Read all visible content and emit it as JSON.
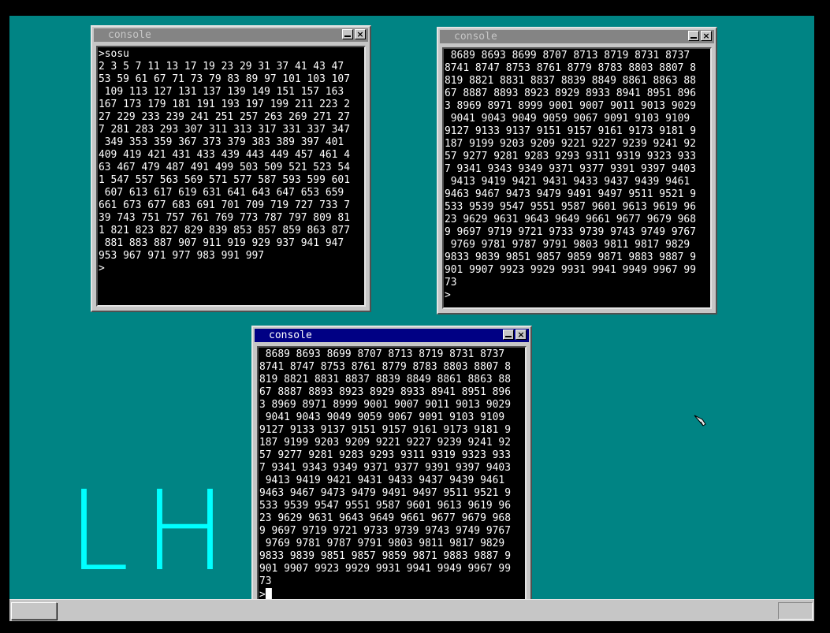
{
  "desktop": {
    "background": "#008484",
    "logo": {
      "letter_l": "L",
      "letter_h": "H",
      "color": "#00ffff"
    }
  },
  "windows": [
    {
      "title": "console",
      "active": false,
      "lines": [
        ">sosu",
        "2 3 5 7 11 13 17 19 23 29 31 37 41 43 47",
        "53 59 61 67 71 73 79 83 89 97 101 103 107",
        " 109 113 127 131 137 139 149 151 157 163",
        "167 173 179 181 191 193 197 199 211 223 2",
        "27 229 233 239 241 251 257 263 269 271 27",
        "7 281 283 293 307 311 313 317 331 337 347",
        " 349 353 359 367 373 379 383 389 397 401",
        "409 419 421 431 433 439 443 449 457 461 4",
        "63 467 479 487 491 499 503 509 521 523 54",
        "1 547 557 563 569 571 577 587 593 599 601",
        " 607 613 617 619 631 641 643 647 653 659",
        "661 673 677 683 691 701 709 719 727 733 7",
        "39 743 751 757 761 769 773 787 797 809 81",
        "1 821 823 827 829 839 853 857 859 863 877",
        " 881 883 887 907 911 919 929 937 941 947",
        "953 967 971 977 983 991 997",
        ">"
      ]
    },
    {
      "title": "console",
      "active": false,
      "lines": [
        " 8689 8693 8699 8707 8713 8719 8731 8737",
        "8741 8747 8753 8761 8779 8783 8803 8807 8",
        "819 8821 8831 8837 8839 8849 8861 8863 88",
        "67 8887 8893 8923 8929 8933 8941 8951 896",
        "3 8969 8971 8999 9001 9007 9011 9013 9029",
        " 9041 9043 9049 9059 9067 9091 9103 9109",
        "9127 9133 9137 9151 9157 9161 9173 9181 9",
        "187 9199 9203 9209 9221 9227 9239 9241 92",
        "57 9277 9281 9283 9293 9311 9319 9323 933",
        "7 9341 9343 9349 9371 9377 9391 9397 9403",
        " 9413 9419 9421 9431 9433 9437 9439 9461",
        "9463 9467 9473 9479 9491 9497 9511 9521 9",
        "533 9539 9547 9551 9587 9601 9613 9619 96",
        "23 9629 9631 9643 9649 9661 9677 9679 968",
        "9 9697 9719 9721 9733 9739 9743 9749 9767",
        " 9769 9781 9787 9791 9803 9811 9817 9829",
        "9833 9839 9851 9857 9859 9871 9883 9887 9",
        "901 9907 9923 9929 9931 9941 9949 9967 99",
        "73",
        ">"
      ]
    },
    {
      "title": "console",
      "active": true,
      "lines": [
        " 8689 8693 8699 8707 8713 8719 8731 8737",
        "8741 8747 8753 8761 8779 8783 8803 8807 8",
        "819 8821 8831 8837 8839 8849 8861 8863 88",
        "67 8887 8893 8923 8929 8933 8941 8951 896",
        "3 8969 8971 8999 9001 9007 9011 9013 9029",
        " 9041 9043 9049 9059 9067 9091 9103 9109",
        "9127 9133 9137 9151 9157 9161 9173 9181 9",
        "187 9199 9203 9209 9221 9227 9239 9241 92",
        "57 9277 9281 9283 9293 9311 9319 9323 933",
        "7 9341 9343 9349 9371 9377 9391 9397 9403",
        " 9413 9419 9421 9431 9433 9437 9439 9461",
        "9463 9467 9473 9479 9491 9497 9511 9521 9",
        "533 9539 9547 9551 9587 9601 9613 9619 96",
        "23 9629 9631 9643 9649 9661 9677 9679 968",
        "9 9697 9719 9721 9733 9739 9743 9749 9767",
        " 9769 9781 9787 9791 9803 9811 9817 9829",
        "9833 9839 9851 9857 9859 9871 9883 9887 9",
        "901 9907 9923 9929 9931 9941 9949 9967 99",
        "73",
        ">"
      ]
    }
  ],
  "colors": {
    "title_active": "#000084",
    "title_inactive": "#848484",
    "window_face": "#c6c6c6",
    "console_bg": "#000000",
    "console_fg": "#ffffff"
  },
  "icons": {
    "minimize": "minimize-icon",
    "close": "close-icon",
    "pointer": "mouse-pointer-icon"
  }
}
